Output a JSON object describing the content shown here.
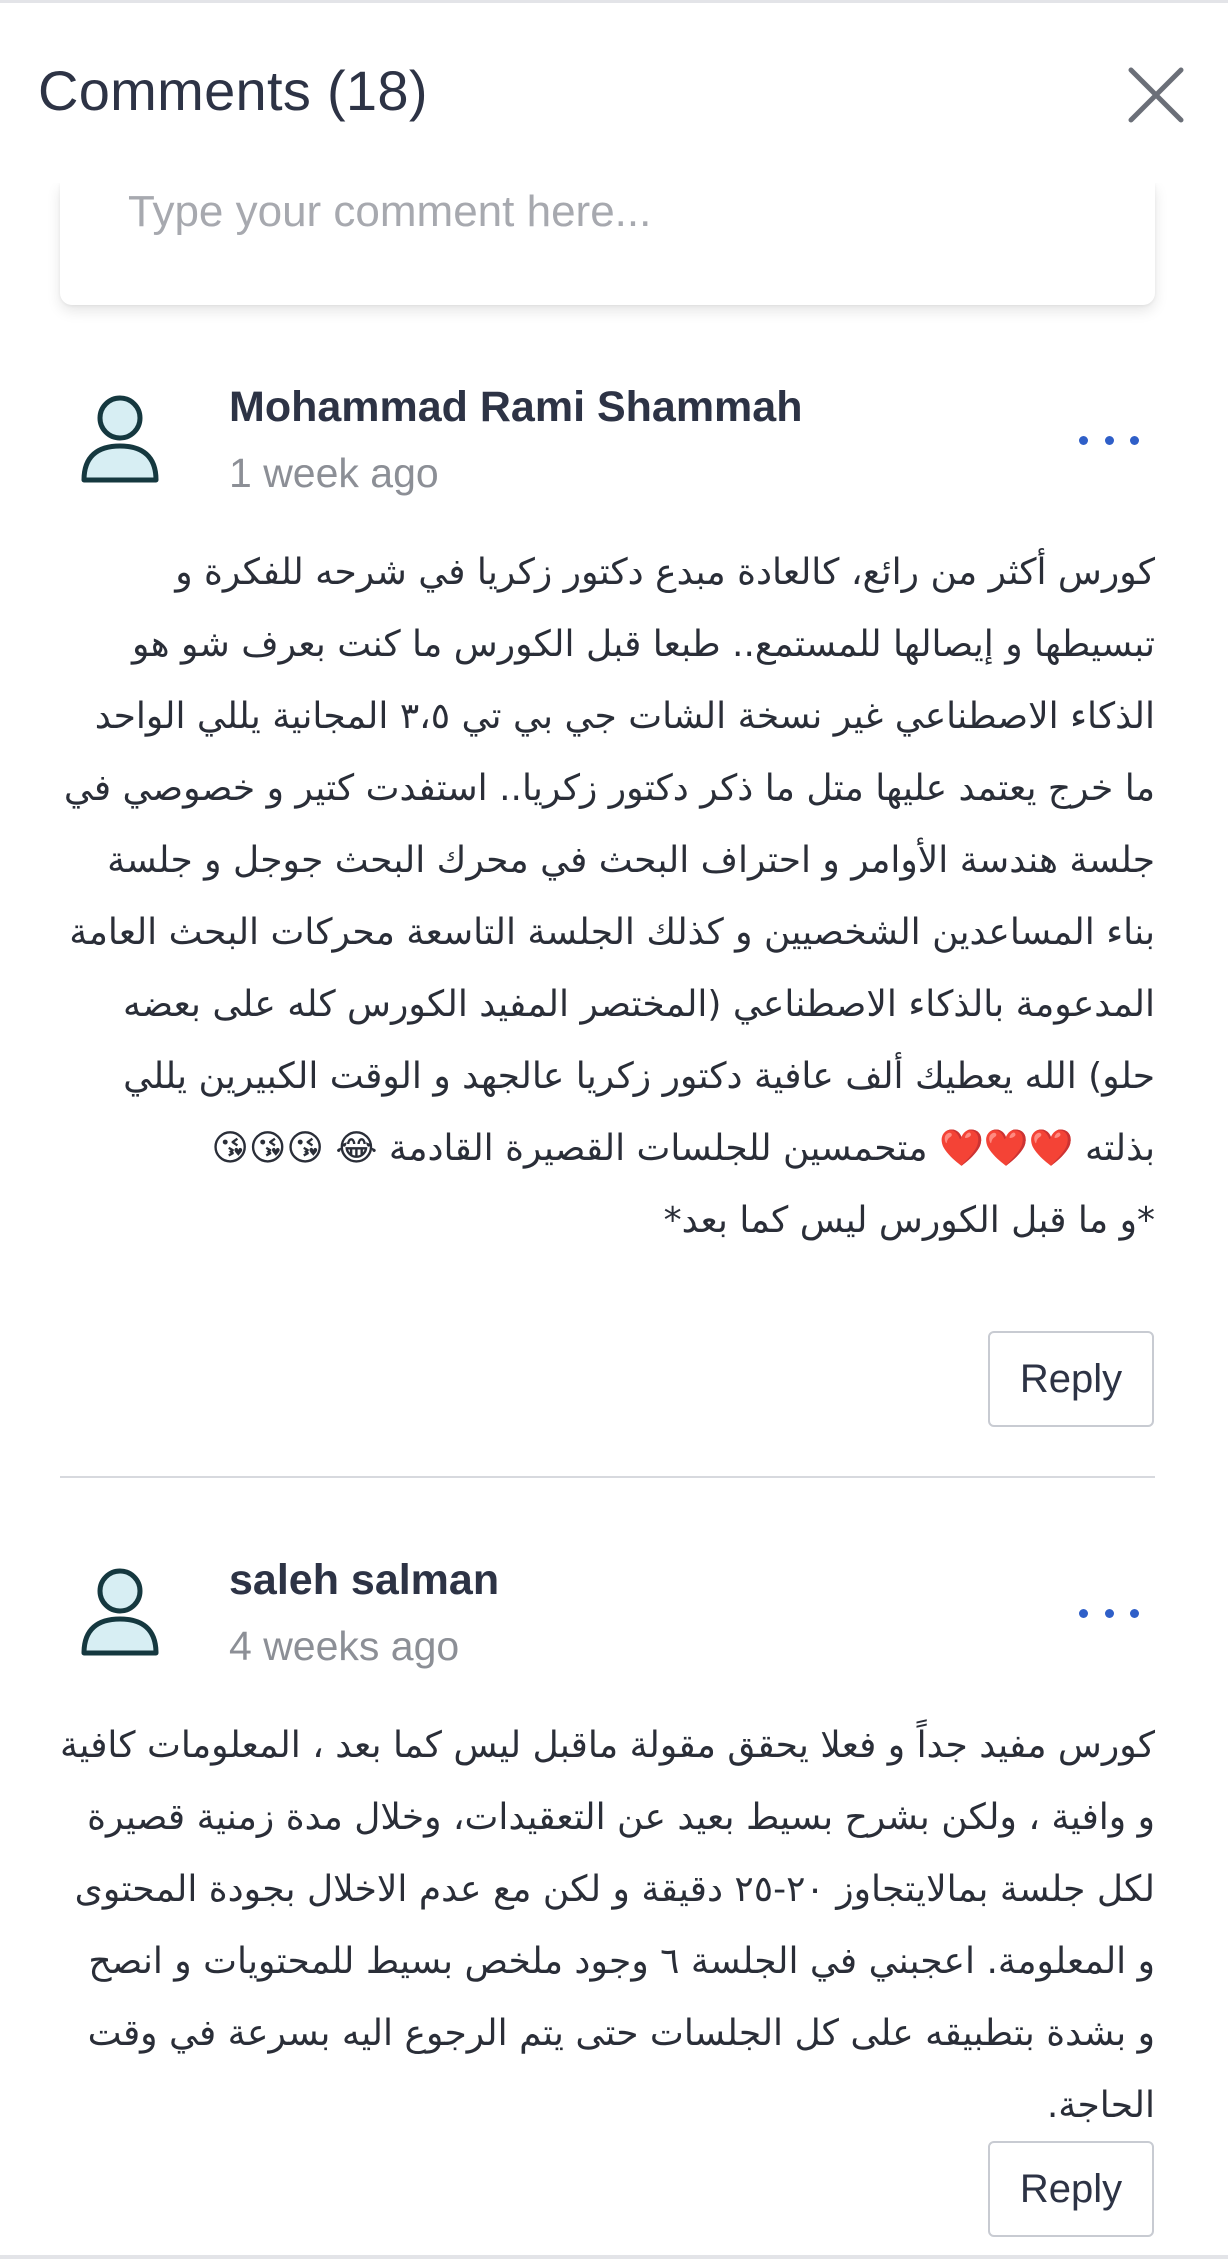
{
  "header": {
    "title": "Comments (18)"
  },
  "comment_input": {
    "placeholder": "Type your comment here..."
  },
  "comments": [
    {
      "author": "Mohammad Rami Shammah",
      "time": "1 week ago",
      "text": "كورس أكثر من رائع، كالعادة مبدع دكتور زكريا في شرحه للفكرة و تبسيطها و إيصالها للمستمع.. طبعا قبل الكورس ما كنت بعرف شو هو الذكاء الاصطناعي غير نسخة الشات جي بي تي ٣،٥ المجانية يللي الواحد ما خرج يعتمد عليها متل ما ذكر دكتور زكريا.. استفدت كتير و خصوصي في جلسة هندسة الأوامر و احتراف البحث في محرك البحث جوجل و جلسة بناء المساعدين الشخصيين و كذلك الجلسة التاسعة محركات البحث العامة المدعومة بالذكاء الاصطناعي (المختصر المفيد الكورس كله على بعضه حلو) الله يعطيك ألف عافية دكتور زكريا عالجهد و الوقت الكبيرين يللي بذلته ❤️❤️❤️ متحمسين للجلسات القصيرة القادمة 😂 😘😘😘\n*و ما قبل الكورس ليس كما بعد*",
      "reply_label": "Reply"
    },
    {
      "author": "saleh salman",
      "time": "4 weeks ago",
      "text": "كورس مفيد جداً و فعلا يحقق مقولة ماقبل ليس كما بعد ، المعلومات كافية و وافية ، ولكن بشرح بسيط بعيد عن التعقيدات، وخلال مدة زمنية قصيرة لكل جلسة بمالايتجاوز ٢٠-٢٥ دقيقة و لكن مع عدم الاخلال بجودة المحتوى و المعلومة. اعجبني في الجلسة ٦ وجود ملخص بسيط للمحتويات و انصح و بشدة بتطبيقه على كل الجلسات حتى يتم الرجوع اليه بسرعة في وقت الحاجة.",
      "reply_label": "Reply"
    }
  ],
  "icons": {
    "close": "close-icon",
    "avatar": "user-avatar-icon",
    "more": "more-options-icon"
  },
  "colors": {
    "accent": "#2f5fc8",
    "avatar_fill": "#d7eef3",
    "avatar_stroke": "#15383f"
  }
}
